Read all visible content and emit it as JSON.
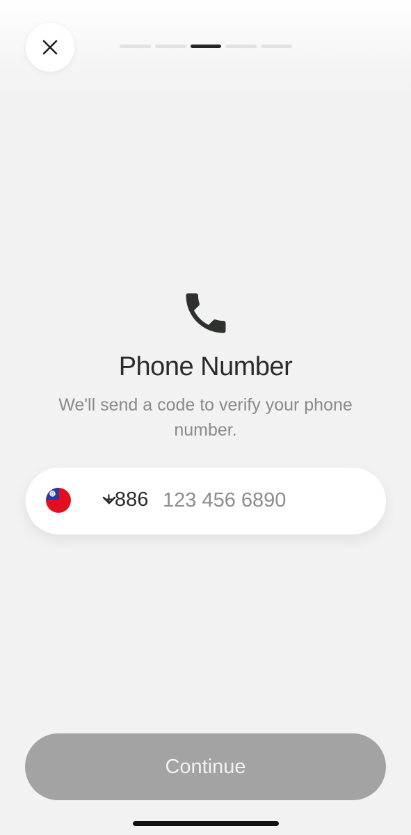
{
  "header": {
    "close_icon": "close-icon",
    "progress": {
      "steps": 5,
      "current_step": 3
    }
  },
  "main": {
    "icon": "phone-icon",
    "title": "Phone Number",
    "subtitle": "We'll send a code to verify your phone number."
  },
  "phone_field": {
    "country_flag": "taiwan-flag-icon",
    "dial_code": "+886",
    "value": "",
    "placeholder": "123 456 6890"
  },
  "footer": {
    "continue_label": "Continue",
    "continue_enabled": false
  },
  "colors": {
    "background": "#f2f2f2",
    "button_disabled": "#a3a3a3",
    "progress_active": "#262626",
    "progress_inactive": "#e2e2e2"
  }
}
